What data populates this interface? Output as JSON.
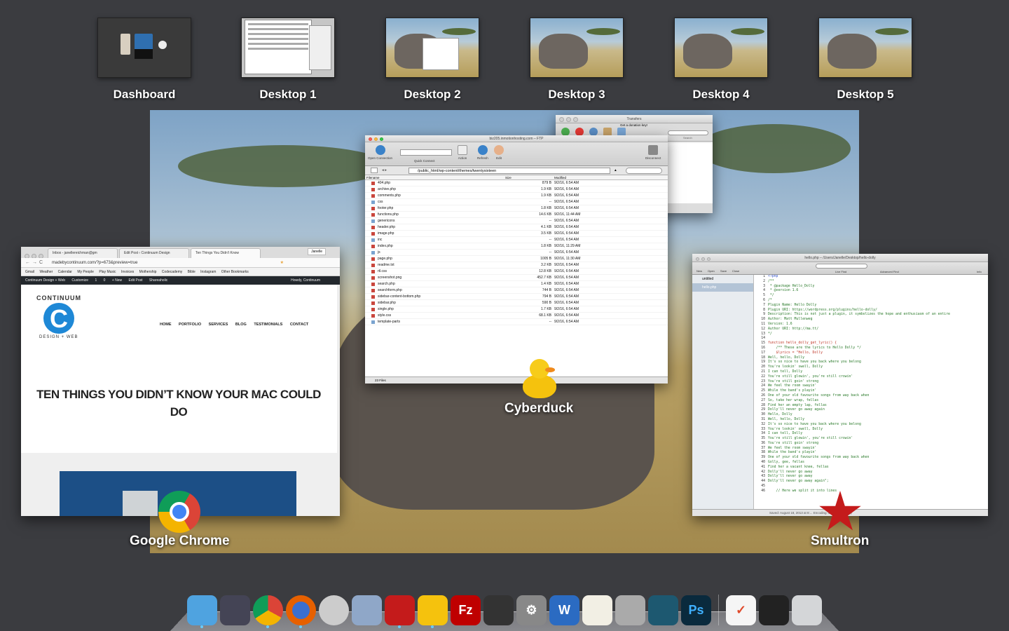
{
  "spaces": [
    {
      "label": "Dashboard"
    },
    {
      "label": "Desktop 1"
    },
    {
      "label": "Desktop 2"
    },
    {
      "label": "Desktop 3"
    },
    {
      "label": "Desktop 4"
    },
    {
      "label": "Desktop 5"
    }
  ],
  "apps": {
    "chrome": {
      "label": "Google Chrome"
    },
    "cyberduck": {
      "label": "Cyberduck"
    },
    "smultron": {
      "label": "Smultron"
    }
  },
  "chrome_window": {
    "tabs": [
      "Inbox - janellereichman@gm",
      "Edit Post ‹ Continuum Design",
      "Ten Things You Didn't Know"
    ],
    "profile": "Janelle",
    "url": "madebycontinuum.com/?p=673&preview=true",
    "bookmarks": [
      "Gmail",
      "Weather",
      "Calendar",
      "My People",
      "Play Music",
      "Invoices",
      "Mothership",
      "Codecademy",
      "Bible",
      "Instagram",
      "Other Bookmarks"
    ],
    "wp_bar": [
      "Continuum Design + Web",
      "Customize",
      "1",
      "0",
      "+ New",
      "Edit Post",
      "Shareaholic"
    ],
    "wp_howdy": "Howdy, Continuum",
    "logo_top": "CONTINUUM",
    "logo_bottom": "DESIGN + WEB",
    "nav": [
      "HOME",
      "PORTFOLIO",
      "SERVICES",
      "BLOG",
      "TESTIMONIALS",
      "CONTACT"
    ],
    "headline": "TEN THINGS YOU DIDN’T KNOW YOUR MAC COULD DO"
  },
  "ftp_window": {
    "title": "biz205.inmotionhosting.com – FTP",
    "toolbar": [
      "Open Connection",
      "Quick Connect",
      "Action",
      "Refresh",
      "Edit",
      "Disconnect"
    ],
    "path": "/public_html/wp-content/themes/twentysixteen",
    "columns": [
      "Filename",
      "Size",
      "Modified"
    ],
    "files": [
      {
        "name": "404.php",
        "size": "879 B",
        "modified": "9/2/16, 6:54 AM",
        "folder": false
      },
      {
        "name": "archive.php",
        "size": "1.9 KB",
        "modified": "9/2/16, 6:54 AM",
        "folder": false
      },
      {
        "name": "comments.php",
        "size": "1.9 KB",
        "modified": "9/2/16, 6:54 AM",
        "folder": false
      },
      {
        "name": "css",
        "size": "--",
        "modified": "9/2/16, 6:54 AM",
        "folder": true
      },
      {
        "name": "footer.php",
        "size": "1.8 KB",
        "modified": "9/2/16, 6:54 AM",
        "folder": false
      },
      {
        "name": "functions.php",
        "size": "14.6 KB",
        "modified": "9/2/16, 11:44 AM",
        "folder": false
      },
      {
        "name": "genericons",
        "size": "--",
        "modified": "9/2/16, 6:54 AM",
        "folder": true
      },
      {
        "name": "header.php",
        "size": "4.1 KB",
        "modified": "9/2/16, 6:54 AM",
        "folder": false
      },
      {
        "name": "image.php",
        "size": "3.5 KB",
        "modified": "9/2/16, 6:54 AM",
        "folder": false
      },
      {
        "name": "inc",
        "size": "--",
        "modified": "9/2/16, 6:54 AM",
        "folder": true
      },
      {
        "name": "index.php",
        "size": "1.8 KB",
        "modified": "9/2/16, 11:29 AM",
        "folder": false
      },
      {
        "name": "js",
        "size": "--",
        "modified": "9/2/16, 6:54 AM",
        "folder": true
      },
      {
        "name": "page.php",
        "size": "1005 B",
        "modified": "9/2/16, 11:30 AM",
        "folder": false
      },
      {
        "name": "readme.txt",
        "size": "3.2 KB",
        "modified": "9/2/16, 6:54 AM",
        "folder": false
      },
      {
        "name": "rtl.css",
        "size": "12.8 KB",
        "modified": "9/2/16, 6:54 AM",
        "folder": false
      },
      {
        "name": "screenshot.png",
        "size": "452.7 KB",
        "modified": "9/2/16, 6:54 AM",
        "folder": false
      },
      {
        "name": "search.php",
        "size": "1.4 KB",
        "modified": "9/2/16, 6:54 AM",
        "folder": false
      },
      {
        "name": "searchform.php",
        "size": "744 B",
        "modified": "9/2/16, 6:54 AM",
        "folder": false
      },
      {
        "name": "sidebar-content-bottom.php",
        "size": "794 B",
        "modified": "9/2/16, 6:54 AM",
        "folder": false
      },
      {
        "name": "sidebar.php",
        "size": "590 B",
        "modified": "9/2/16, 6:54 AM",
        "folder": false
      },
      {
        "name": "single.php",
        "size": "1.7 KB",
        "modified": "9/2/16, 6:54 AM",
        "folder": false
      },
      {
        "name": "style.css",
        "size": "68.1 KB",
        "modified": "9/2/16, 6:54 AM",
        "folder": false
      },
      {
        "name": "template-parts",
        "size": "--",
        "modified": "9/2/16, 6:54 AM",
        "folder": true
      }
    ],
    "status": "23 Files"
  },
  "transfers_window": {
    "title": "Transfers",
    "donation": "Get a donation key!",
    "search": "Search"
  },
  "smultron_window": {
    "title": "hello.php – /Users/Janelle/Desktop/hello-dolly",
    "toolbar": [
      "New",
      "Open",
      "Save",
      "Close",
      "Live Find",
      "Advanced Find",
      "Info"
    ],
    "docs": [
      "untitled",
      "hello.php"
    ],
    "status": "Saved: August 18, 2013 at 8:...    Encoding: Unicode (UTF-8)",
    "lines": [
      "<?php",
      "/**",
      " * @package Hello_Dolly",
      " * @version 1.6",
      " */",
      "/*",
      "Plugin Name: Hello Dolly",
      "Plugin URI: https://wordpress.org/plugins/hello-dolly/",
      "Description: This is not just a plugin, it symbolizes the hope and enthusiasm of an entire",
      "Author: Matt Mullenweg",
      "Version: 1.6",
      "Author URI: http://ma.tt/",
      "*/",
      "",
      "function hello_dolly_get_lyric() {",
      "    /** These are the lyrics to Hello Dolly */",
      "    $lyrics = \"Hello, Dolly",
      "Well, hello, Dolly",
      "It's so nice to have you back where you belong",
      "You're lookin' swell, Dolly",
      "I can tell, Dolly",
      "You're still glowin', you're still crowin'",
      "You're still goin' strong",
      "We feel the room swayin'",
      "While the band's playin'",
      "One of your old favourite songs from way back when",
      "So, take her wrap, fellas",
      "Find her an empty lap, fellas",
      "Dolly'll never go away again",
      "Hello, Dolly",
      "Well, hello, Dolly",
      "It's so nice to have you back where you belong",
      "You're lookin' swell, Dolly",
      "I can tell, Dolly",
      "You're still glowin', you're still crowin'",
      "You're still goin' strong",
      "We feel the room swayin'",
      "While the band's playin'",
      "One of your old favourite songs from way back when",
      "Golly, gee, fellas",
      "Find her a vacant knee, fellas",
      "Dolly'll never go away",
      "Dolly'll never go away",
      "Dolly'll never go away again\";",
      "",
      "    // Here we split it into lines"
    ]
  },
  "dock": [
    "finder",
    "mission-control",
    "chrome",
    "firefox",
    "contacts",
    "preview",
    "smultron",
    "cyberduck",
    "filezilla",
    "terminal",
    "system-preferences",
    "word",
    "textedit",
    "calculator",
    "dreamweaver",
    "photoshop",
    "omnifocus",
    "activity-monitor",
    "trash"
  ]
}
